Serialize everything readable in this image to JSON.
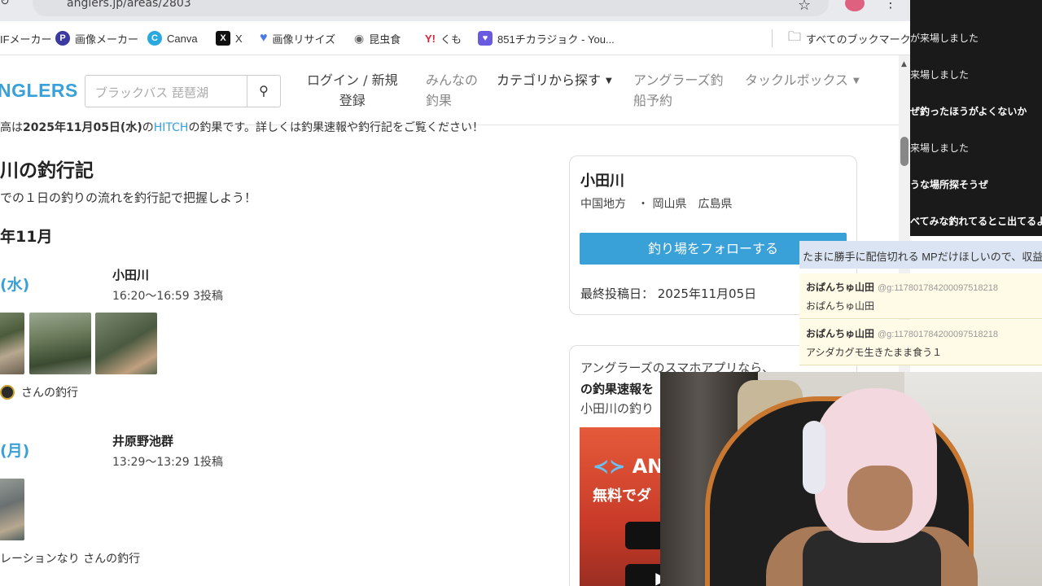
{
  "browser": {
    "url": "anglers.jp/areas/2803",
    "bookmarks": [
      {
        "label": "IFメーカー",
        "icon": "gif-maker-icon",
        "color": "#7a5af0"
      },
      {
        "label": "画像メーカー",
        "icon": "image-maker-icon",
        "color": "#3a3aa0"
      },
      {
        "label": "Canva",
        "icon": "canva-icon",
        "color": "#2aa8e0"
      },
      {
        "label": "X",
        "icon": "x-icon",
        "color": "#111111"
      },
      {
        "label": "画像リサイズ",
        "icon": "heart-icon",
        "color": "#4a7ae0"
      },
      {
        "label": "昆虫食",
        "icon": "eye-icon",
        "color": "#666666"
      },
      {
        "label": "くも",
        "icon": "yahoo-icon",
        "color": "#e0203a"
      },
      {
        "label": "851チカラジョク - You...",
        "icon": "heart-shield-icon",
        "color": "#6a5ae0"
      }
    ],
    "all_bookmarks": "すべてのブックマーク"
  },
  "site": {
    "logo": "GLERS",
    "search_placeholder": "ブラックバス 琵琶湖",
    "nav": {
      "login_line1": "ログイン / 新規",
      "login_line2": "登録",
      "minna_line1": "みんなの",
      "minna_line2": "釣果",
      "category": "カテゴリから探す",
      "ship_line1": "アングラーズ釣",
      "ship_line2": "船予約",
      "tacklebox": "タックルボックス"
    }
  },
  "main": {
    "partial_top_a": "高は",
    "partial_top_b": "2025年11月05日(水)",
    "partial_top_c": "の",
    "partial_top_d": "HITCH",
    "partial_top_e": "の釣果です。詳しくは釣果速報や釣行記をご覧ください！",
    "title": "川の釣行記",
    "subtitle": "での１日の釣りの流れを釣行記で把握しよう！",
    "month": "年11月",
    "entries": [
      {
        "day": "(水)",
        "spot": "小田川",
        "time": "16:20〜16:59   3投稿",
        "byline": "さんの釣行"
      },
      {
        "day": "(月)",
        "spot": "井原野池群",
        "time": "13:29〜13:29   1投稿",
        "byline": "レーションなり さんの釣行"
      }
    ]
  },
  "sidebar": {
    "name": "小田川",
    "region": "中国地方　・ 岡山県　広島県",
    "follow": "釣り場をフォローする",
    "last_post": "最終投稿日：  2025年11月05日",
    "app_line1": "アングラーズのスマホアプリなら、",
    "app_line2": "の釣果速報を",
    "app_line3": "小田川の釣り",
    "ad_brand": "AN",
    "ad_free": "無料でダ"
  },
  "chat": {
    "lines": [
      "が来場しました",
      "来場しました",
      "ぜ釣ったほうがよくないか",
      "来場しました",
      "うな場所探そうぜ",
      "べてみな釣れてるとこ出てるよ"
    ],
    "ticker": "たまに勝手に配信切れる MPだけほしいので、収益",
    "comments": [
      {
        "user": "おぱんちゅ山田",
        "gid": "@g:117801784200097518218",
        "msg": "おぱんちゅ山田"
      },
      {
        "user": "おぱんちゅ山田",
        "gid": "@g:117801784200097518218",
        "msg": "アシダカグモ生きたまま食う１"
      }
    ]
  }
}
